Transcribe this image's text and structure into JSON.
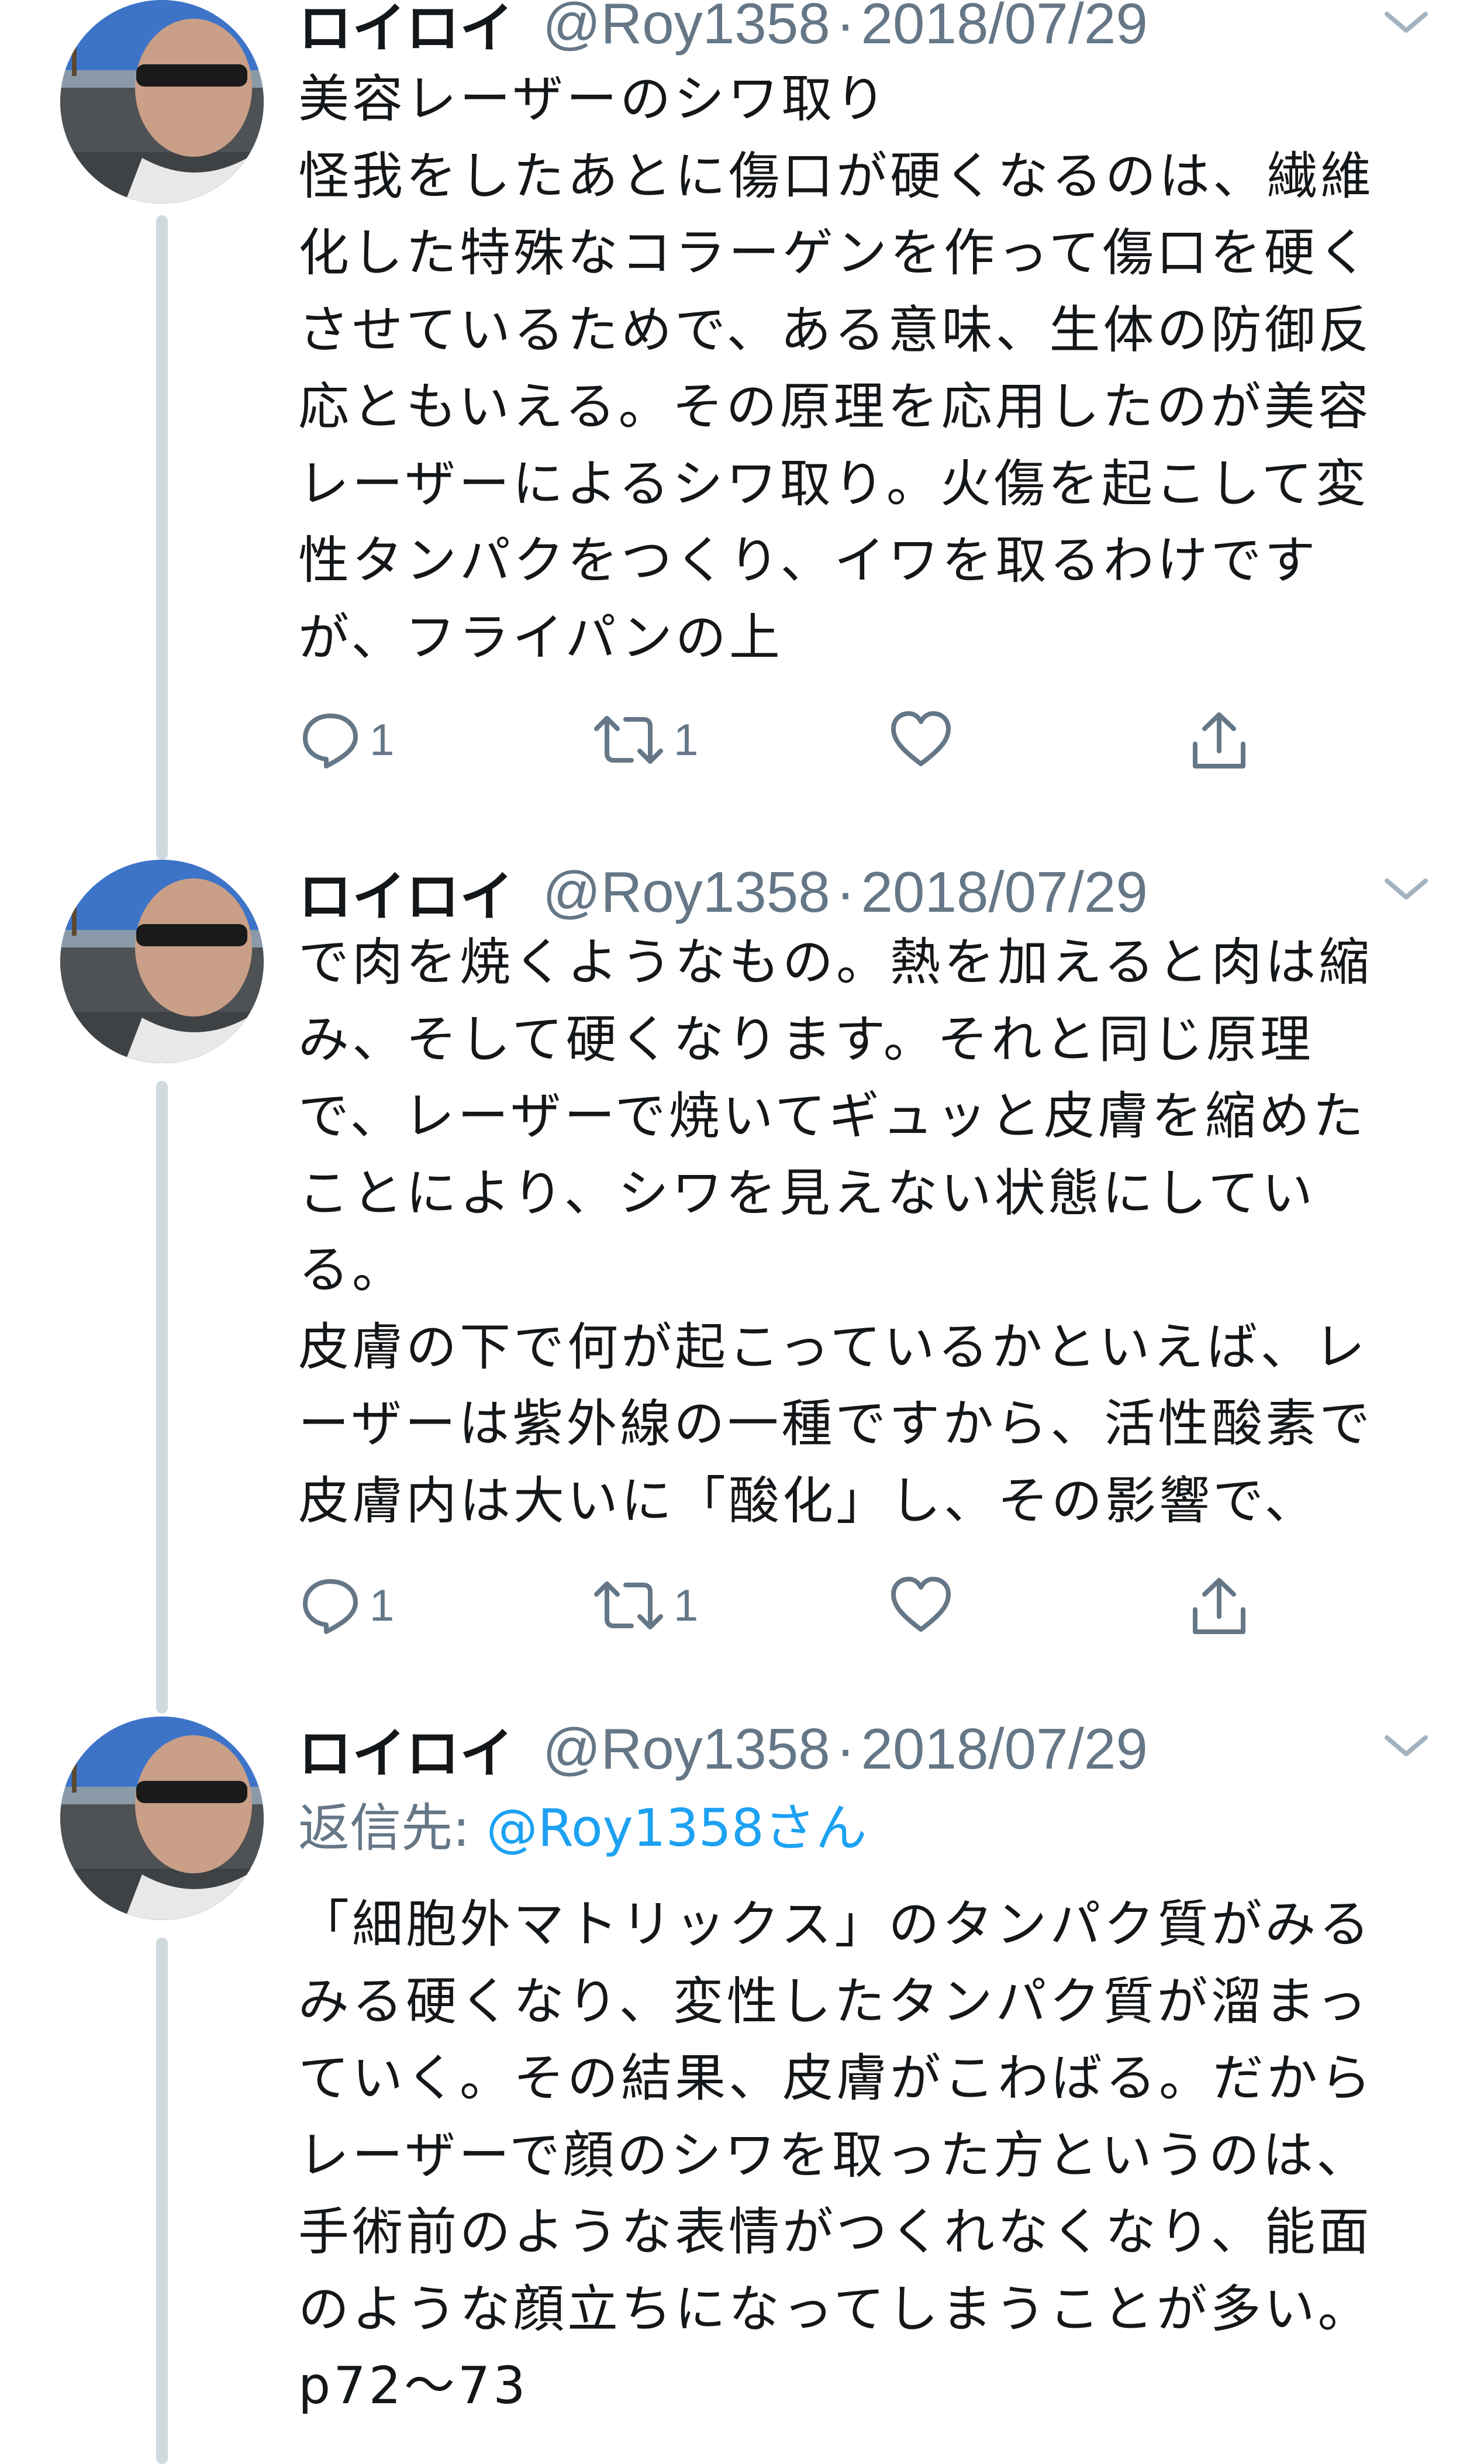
{
  "tweets": [
    {
      "display_name": "ロイロイ",
      "handle": "@Roy1358",
      "separator": "·",
      "date": "2018/07/29",
      "body_lines": [
        "美容レーザーのシワ取り",
        "怪我をしたあとに傷口が硬くなるのは、繊維",
        "化した特殊なコラーゲンを作って傷口を硬く",
        "させているためで、ある意味、生体の防御反",
        "応ともいえる。その原理を応用したのが美容",
        "レーザーによるシワ取り。火傷を起こして変",
        "性タンパクをつくり、イワを取るわけです",
        "が、フライパンの上"
      ],
      "reply_count": "1",
      "retweet_count": "1"
    },
    {
      "display_name": "ロイロイ",
      "handle": "@Roy1358",
      "separator": "·",
      "date": "2018/07/29",
      "body_lines": [
        "で肉を焼くようなもの。熱を加えると肉は縮",
        "み、そして硬くなります。それと同じ原理",
        "で、レーザーで焼いてギュッと皮膚を縮めた",
        "ことにより、シワを見えない状態にしてい",
        "る。",
        "皮膚の下で何が起こっているかといえば、レ",
        "ーザーは紫外線の一種ですから、活性酸素で",
        "皮膚内は大いに「酸化」し、その影響で、"
      ],
      "reply_count": "1",
      "retweet_count": "1"
    },
    {
      "display_name": "ロイロイ",
      "handle": "@Roy1358",
      "separator": "·",
      "date": "2018/07/29",
      "reply_to_prefix": "返信先: ",
      "reply_to_mention": "@Roy1358さん",
      "body_lines": [
        "「細胞外マトリックス」のタンパク質がみる",
        "みる硬くなり、変性したタンパク質が溜まっ",
        "ていく。その結果、皮膚がこわばる。だから",
        "レーザーで顔のシワを取った方というのは、",
        "手術前のような表情がつくれなくなり、能面",
        "のような顔立ちになってしまうことが多い。",
        "p72〜73"
      ]
    }
  ],
  "colors": {
    "text_primary": "#14171a",
    "text_secondary": "#657786",
    "mention": "#1da1f2",
    "thread_line": "#cfd9de"
  },
  "icons": {
    "reply": "reply-icon",
    "retweet": "retweet-icon",
    "like": "heart-icon",
    "share": "share-icon",
    "caret": "chevron-down-icon"
  }
}
